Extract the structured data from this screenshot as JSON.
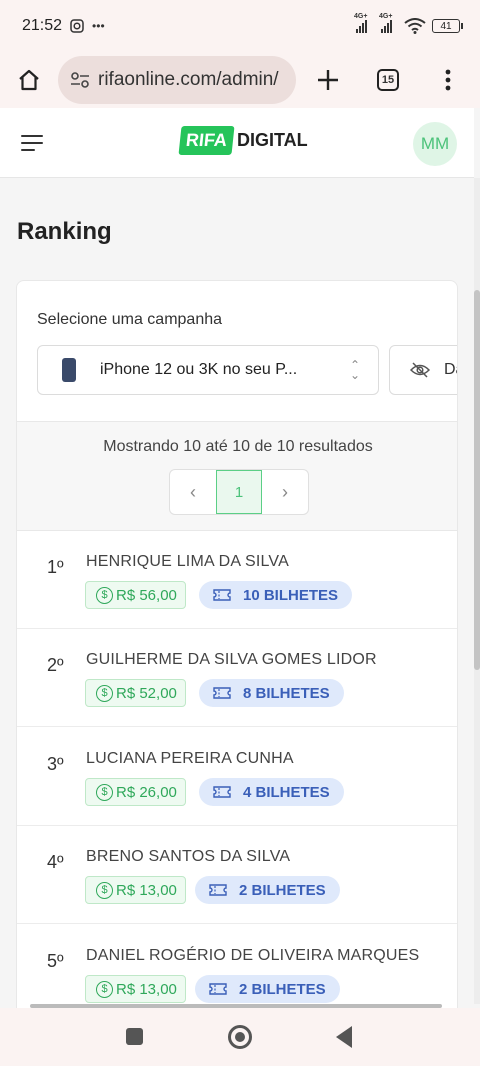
{
  "status_bar": {
    "time": "21:52",
    "dots": "•••",
    "network_1": "4G+",
    "network_2": "4G+",
    "battery": "41"
  },
  "browser": {
    "url": "rifaonline.com/admin/",
    "tab_count": "15"
  },
  "header": {
    "logo_part1": "RIFA",
    "logo_part2": "DIGITAL",
    "avatar_initials": "MM"
  },
  "page": {
    "title": "Ranking"
  },
  "campaign": {
    "label": "Selecione uma campanha",
    "selected": "iPhone 12 ou 3K no seu P...",
    "toggle_label": "Dados"
  },
  "results": {
    "text": "Mostrando 10 até 10 de 10 resultados",
    "current_page": "1",
    "prev": "‹",
    "next": "›"
  },
  "ranking": [
    {
      "position": "1º",
      "name": "HENRIQUE LIMA DA SILVA",
      "amount": "R$ 56,00",
      "tickets": "10 BILHETES"
    },
    {
      "position": "2º",
      "name": "GUILHERME DA SILVA GOMES LIDOR",
      "amount": "R$ 52,00",
      "tickets": "8 BILHETES"
    },
    {
      "position": "3º",
      "name": "LUCIANA PEREIRA CUNHA",
      "amount": "R$ 26,00",
      "tickets": "4 BILHETES"
    },
    {
      "position": "4º",
      "name": "BRENO SANTOS DA SILVA",
      "amount": "R$ 13,00",
      "tickets": "2 BILHETES"
    },
    {
      "position": "5º",
      "name": "DANIEL ROGÉRIO DE OLIVEIRA MARQUES",
      "amount": "R$ 13,00",
      "tickets": "2 BILHETES"
    }
  ],
  "colors": {
    "accent_green": "#25c45a",
    "ticket_blue": "#3a5fb8"
  }
}
